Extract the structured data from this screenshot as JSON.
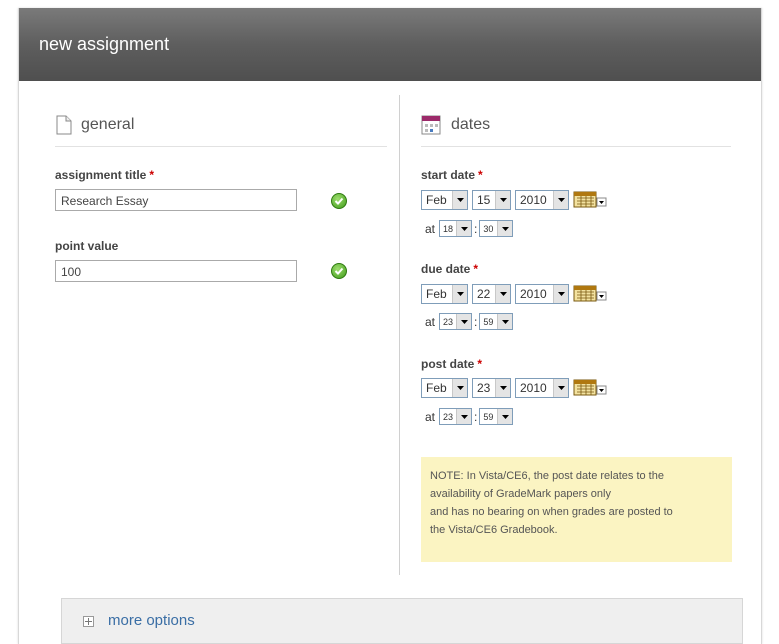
{
  "header": {
    "title": "new assignment"
  },
  "general": {
    "heading": "general",
    "fields": [
      {
        "label": "assignment title",
        "required_mark": "*",
        "value": "Research Essay"
      },
      {
        "label": "point value",
        "value": "100"
      }
    ]
  },
  "dates": {
    "heading": "dates",
    "at_label": "at",
    "colon": ":",
    "required_mark": "*",
    "items": [
      {
        "label": "start date",
        "month": "Feb",
        "day": "15",
        "year": "2010",
        "hour": "18",
        "minute": "30"
      },
      {
        "label": "due date",
        "month": "Feb",
        "day": "22",
        "year": "2010",
        "hour": "23",
        "minute": "59"
      },
      {
        "label": "post date",
        "month": "Feb",
        "day": "23",
        "year": "2010",
        "hour": "23",
        "minute": "59"
      }
    ],
    "note_lines": [
      "NOTE: In Vista/CE6, the post date relates to the",
      "availability of GradeMark papers only",
      "and has no bearing on when grades are posted to",
      "the Vista/CE6 Gradebook."
    ]
  },
  "more_options": {
    "label": "more options"
  },
  "colors": {
    "header": "#5e5e5e",
    "required": "#cc0000",
    "link": "#3a6ea5",
    "note_bg": "#fbf4c2",
    "ok": "#3f9a1a"
  }
}
